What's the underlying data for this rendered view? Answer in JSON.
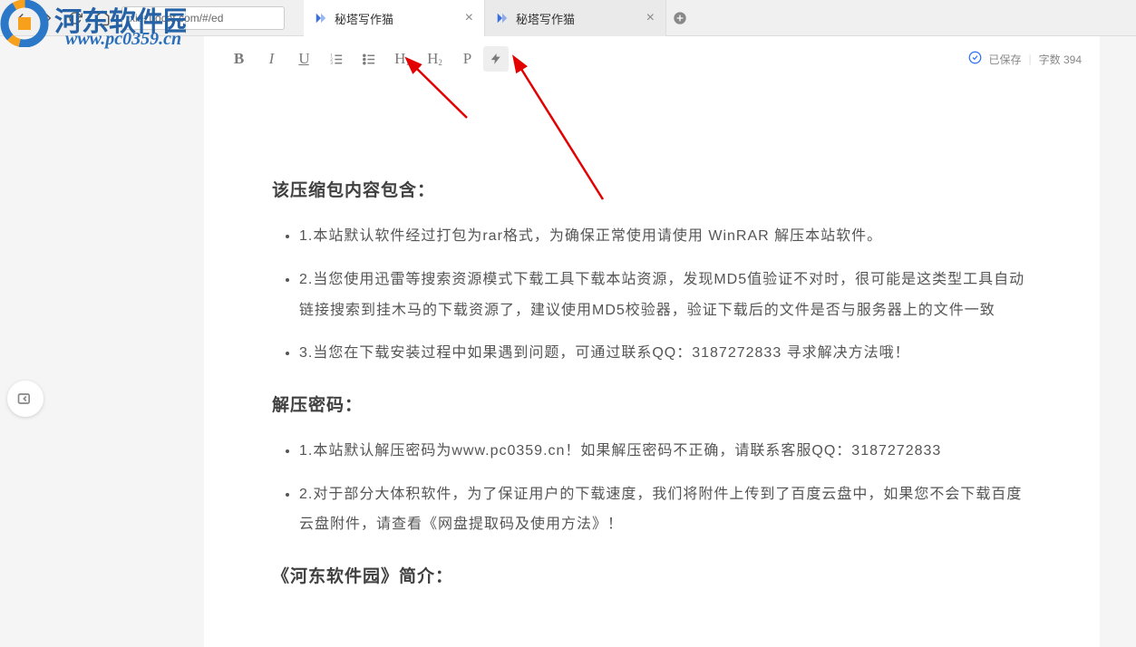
{
  "browser": {
    "url": "xiezuocat.com/#/ed",
    "tabs": [
      {
        "label": "秘塔写作猫",
        "active": true
      },
      {
        "label": "秘塔写作猫",
        "active": false
      }
    ]
  },
  "watermark": {
    "title_chars": [
      "河",
      "东",
      "软",
      "件",
      "园"
    ],
    "url": "www.pc0359.cn"
  },
  "toolbar": {
    "bold": "B",
    "italic": "I",
    "underline": "U",
    "h1": "H",
    "h2": "H",
    "p": "P",
    "lightning": "⚡"
  },
  "status": {
    "saved_label": "已保存",
    "wordcount_label": "字数 394"
  },
  "document": {
    "h1": "该压缩包内容包含：",
    "list1": [
      "1.本站默认软件经过打包为rar格式，为确保正常使用请使用 WinRAR 解压本站软件。",
      "2.当您使用迅雷等搜索资源模式下载工具下载本站资源，发现MD5值验证不对时，很可能是这类型工具自动链接搜索到挂木马的下载资源了，建议使用MD5校验器，验证下载后的文件是否与服务器上的文件一致",
      "3.当您在下载安装过程中如果遇到问题，可通过联系QQ：3187272833 寻求解决方法哦！"
    ],
    "h2": "解压密码：",
    "list2": [
      "1.本站默认解压密码为www.pc0359.cn！如果解压密码不正确，请联系客服QQ：3187272833",
      "2.对于部分大体积软件，为了保证用户的下载速度，我们将附件上传到了百度云盘中，如果您不会下载百度云盘附件，请查看《网盘提取码及使用方法》！"
    ],
    "h3": "《河东软件园》简介："
  }
}
